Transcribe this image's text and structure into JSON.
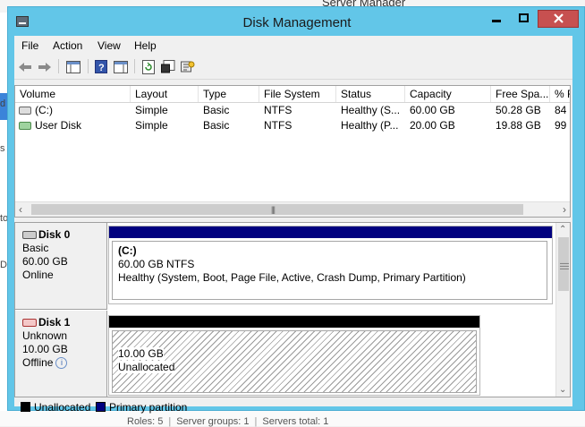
{
  "background": {
    "title": "Server Manager",
    "left_fragments": [
      "d",
      "s",
      "to",
      "De"
    ],
    "status": [
      "Roles: 5",
      "Server groups: 1",
      "Servers total: 1"
    ]
  },
  "window": {
    "title": "Disk Management",
    "controls": {
      "minimize": "—",
      "maximize": "☐",
      "close": "✕"
    }
  },
  "menu": [
    "File",
    "Action",
    "View",
    "Help"
  ],
  "toolbar": [
    "back-icon",
    "forward-icon",
    "show-hide-console-tree-icon",
    "help-icon",
    "show-hide-action-pane-icon",
    "refresh-icon",
    "properties-icon",
    "rescan-disks-icon"
  ],
  "volume_list": {
    "columns": [
      "Volume",
      "Layout",
      "Type",
      "File System",
      "Status",
      "Capacity",
      "Free Spa...",
      "% F"
    ],
    "rows": [
      {
        "volume": "(C:)",
        "layout": "Simple",
        "type": "Basic",
        "fs": "NTFS",
        "status": "Healthy (S...",
        "capacity": "60.00 GB",
        "free": "50.28 GB",
        "pct": "84"
      },
      {
        "volume": "User Disk",
        "layout": "Simple",
        "type": "Basic",
        "fs": "NTFS",
        "status": "Healthy (P...",
        "capacity": "20.00 GB",
        "free": "19.88 GB",
        "pct": "99"
      }
    ]
  },
  "disks": [
    {
      "name": "Disk 0",
      "type": "Basic",
      "size": "60.00 GB",
      "state": "Online",
      "partition": {
        "label": "(C:)",
        "size": "60.00 GB NTFS",
        "status": "Healthy (System, Boot, Page File, Active, Crash Dump, Primary Partition)"
      }
    },
    {
      "name": "Disk 1",
      "type": "Unknown",
      "size": "10.00 GB",
      "state": "Offline",
      "partition": {
        "size": "10.00 GB",
        "status": "Unallocated"
      }
    }
  ],
  "legend": {
    "unallocated": {
      "label": "Unallocated",
      "color": "#000000"
    },
    "primary": {
      "label": "Primary partition",
      "color": "#00007f"
    }
  },
  "colors": {
    "titlebar": "#62c6e8",
    "close_button": "#c75050",
    "primary_bar": "#00007f"
  }
}
